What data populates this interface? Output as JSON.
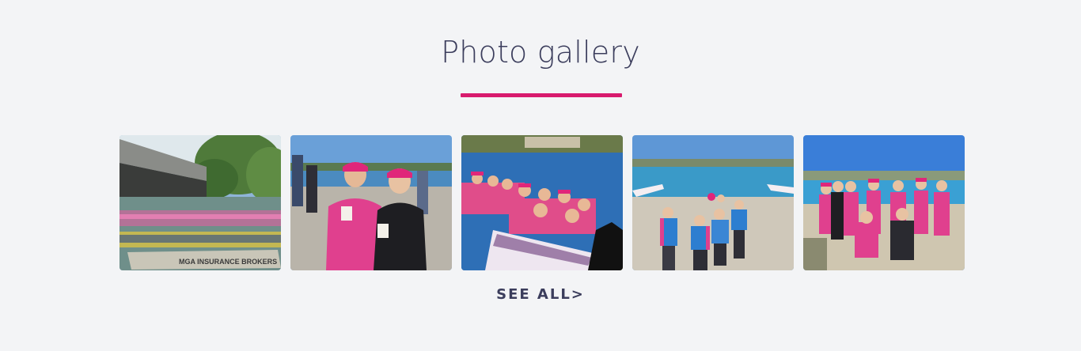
{
  "gallery": {
    "title": "Photo gallery",
    "see_all_label": "SEE ALL>",
    "accent_color": "#d81b6e",
    "photos": [
      {
        "subject": "dragon-boat-race-under-bridge",
        "boat_text": "MGA INSURANCE BROKERS"
      },
      {
        "subject": "two-paddlers-with-coffee"
      },
      {
        "subject": "crew-seated-in-boat"
      },
      {
        "subject": "paddlers-in-life-vests-on-beach"
      },
      {
        "subject": "team-group-photo"
      }
    ]
  }
}
